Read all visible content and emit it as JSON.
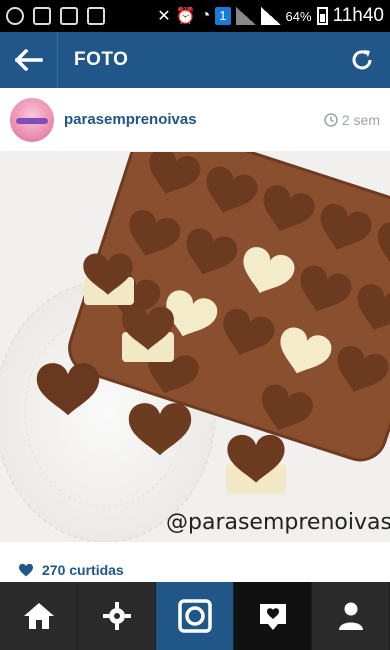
{
  "status_bar": {
    "notification_badge": "1",
    "battery": "64%",
    "time": "11h40"
  },
  "action_bar": {
    "title": "FOTO"
  },
  "post": {
    "username": "parasemprenoivas",
    "time_ago": "2 sem",
    "watermark": "@parasemprenoivas",
    "likes": "270 curtidas"
  },
  "icons": {
    "back": "arrow-left-icon",
    "refresh": "refresh-icon",
    "clock": "clock-icon",
    "heart": "heart-icon",
    "nav": [
      "home-icon",
      "explore-icon",
      "camera-icon",
      "activity-icon",
      "profile-icon"
    ]
  },
  "colors": {
    "brand_blue": "#205688",
    "nav_dark": "#2b2b2b",
    "chocolate": "#7b4a2b",
    "white_chocolate": "#f3e8c6"
  }
}
